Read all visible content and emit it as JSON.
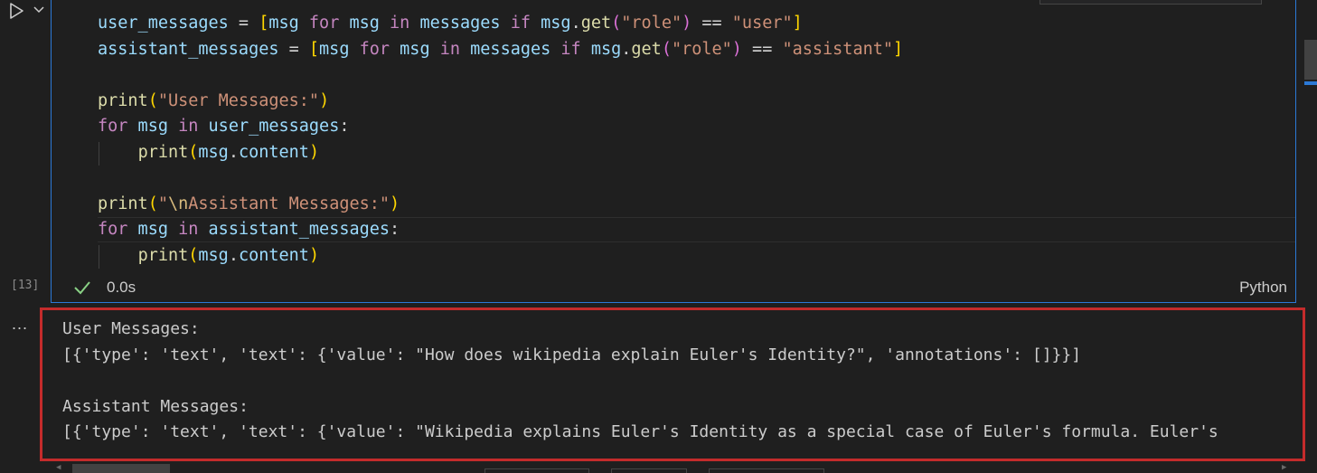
{
  "cell": {
    "code_lines": [
      {
        "id": "l1",
        "parts": [
          {
            "t": "user_messages",
            "c": "var"
          },
          {
            "t": " = ",
            "c": "op"
          },
          {
            "t": "[",
            "c": "br1"
          },
          {
            "t": "msg",
            "c": "var"
          },
          {
            "t": " for ",
            "c": "kw"
          },
          {
            "t": "msg",
            "c": "var"
          },
          {
            "t": " in ",
            "c": "kw"
          },
          {
            "t": "messages",
            "c": "var"
          },
          {
            "t": " if ",
            "c": "kw"
          },
          {
            "t": "msg",
            "c": "var"
          },
          {
            "t": ".",
            "c": "op"
          },
          {
            "t": "get",
            "c": "fn"
          },
          {
            "t": "(",
            "c": "br2"
          },
          {
            "t": "\"role\"",
            "c": "str"
          },
          {
            "t": ")",
            "c": "br2"
          },
          {
            "t": " == ",
            "c": "op"
          },
          {
            "t": "\"user\"",
            "c": "str"
          },
          {
            "t": "]",
            "c": "br1"
          }
        ]
      },
      {
        "id": "l2",
        "parts": [
          {
            "t": "assistant_messages",
            "c": "var"
          },
          {
            "t": " = ",
            "c": "op"
          },
          {
            "t": "[",
            "c": "br1"
          },
          {
            "t": "msg",
            "c": "var"
          },
          {
            "t": " for ",
            "c": "kw"
          },
          {
            "t": "msg",
            "c": "var"
          },
          {
            "t": " in ",
            "c": "kw"
          },
          {
            "t": "messages",
            "c": "var"
          },
          {
            "t": " if ",
            "c": "kw"
          },
          {
            "t": "msg",
            "c": "var"
          },
          {
            "t": ".",
            "c": "op"
          },
          {
            "t": "get",
            "c": "fn"
          },
          {
            "t": "(",
            "c": "br2"
          },
          {
            "t": "\"role\"",
            "c": "str"
          },
          {
            "t": ")",
            "c": "br2"
          },
          {
            "t": " == ",
            "c": "op"
          },
          {
            "t": "\"assistant\"",
            "c": "str"
          },
          {
            "t": "]",
            "c": "br1"
          }
        ]
      },
      {
        "id": "l3",
        "parts": []
      },
      {
        "id": "l4",
        "parts": [
          {
            "t": "print",
            "c": "fn"
          },
          {
            "t": "(",
            "c": "br1"
          },
          {
            "t": "\"User Messages:\"",
            "c": "str"
          },
          {
            "t": ")",
            "c": "br1"
          }
        ]
      },
      {
        "id": "l5",
        "parts": [
          {
            "t": "for",
            "c": "kw"
          },
          {
            "t": " msg ",
            "c": "var"
          },
          {
            "t": "in",
            "c": "kw"
          },
          {
            "t": " user_messages",
            "c": "var"
          },
          {
            "t": ":",
            "c": "op"
          }
        ]
      },
      {
        "id": "l6",
        "parts": [
          {
            "t": "    ",
            "c": "op"
          },
          {
            "t": "print",
            "c": "fn"
          },
          {
            "t": "(",
            "c": "br1"
          },
          {
            "t": "msg",
            "c": "var"
          },
          {
            "t": ".",
            "c": "op"
          },
          {
            "t": "content",
            "c": "var"
          },
          {
            "t": ")",
            "c": "br1"
          }
        ]
      },
      {
        "id": "l7",
        "parts": []
      },
      {
        "id": "l8",
        "parts": [
          {
            "t": "print",
            "c": "fn"
          },
          {
            "t": "(",
            "c": "br1"
          },
          {
            "t": "\"",
            "c": "str"
          },
          {
            "t": "\\n",
            "c": "esc"
          },
          {
            "t": "Assistant Messages:\"",
            "c": "str"
          },
          {
            "t": ")",
            "c": "br1"
          }
        ]
      },
      {
        "id": "l9",
        "parts": [
          {
            "t": "for",
            "c": "kw"
          },
          {
            "t": " msg ",
            "c": "var"
          },
          {
            "t": "in",
            "c": "kw"
          },
          {
            "t": " assistant_messages",
            "c": "var"
          },
          {
            "t": ":",
            "c": "op"
          }
        ]
      },
      {
        "id": "l10",
        "parts": [
          {
            "t": "    ",
            "c": "op"
          },
          {
            "t": "print",
            "c": "fn"
          },
          {
            "t": "(",
            "c": "br1"
          },
          {
            "t": "msg",
            "c": "var"
          },
          {
            "t": ".",
            "c": "op"
          },
          {
            "t": "content",
            "c": "var"
          },
          {
            "t": ")",
            "c": "br1"
          }
        ]
      }
    ],
    "execution_count": "[13]",
    "duration": "0.0s",
    "language": "Python"
  },
  "output": {
    "more_label": "...",
    "lines": [
      "User Messages:",
      "[{'type': 'text', 'text': {'value': \"How does wikipedia explain Euler's Identity?\", 'annotations': []}}]",
      "",
      "Assistant Messages:",
      "[{'type': 'text', 'text': {'value': \"Wikipedia explains Euler's Identity as a special case of Euler's formula. Euler's"
    ]
  },
  "colors": {
    "cell_border": "#2b79d6",
    "output_highlight": "#c42b2b",
    "success": "#89d185"
  },
  "icons": [
    "run-icon",
    "chevron-down-icon",
    "check-icon"
  ]
}
